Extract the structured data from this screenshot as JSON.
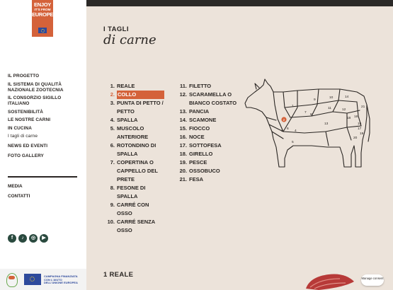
{
  "logo": {
    "line1": "ENJOY",
    "line2": "IT'S FROM",
    "line3": "EUROPE"
  },
  "nav": {
    "items": [
      {
        "label": "IL PROGETTO"
      },
      {
        "label": "IL SISTEMA DI QUALITÀ NAZIONALE ZOOTECNIA"
      },
      {
        "label": "IL CONSORZIO SIGILLO ITALIANO"
      },
      {
        "label": "SOSTENIBILITÀ"
      },
      {
        "label": "LE NOSTRE CARNI"
      },
      {
        "label": "IN CUCINA"
      },
      {
        "label": "I tagli di carne"
      },
      {
        "label": "NEWS ED EVENTI"
      },
      {
        "label": "FOTO GALLERY"
      }
    ],
    "secondary": [
      {
        "label": "MEDIA"
      },
      {
        "label": "CONTATTI"
      }
    ]
  },
  "socials": [
    {
      "icon": "facebook-icon",
      "glyph": "f"
    },
    {
      "icon": "tiktok-icon",
      "glyph": "♪"
    },
    {
      "icon": "instagram-icon",
      "glyph": "◎"
    },
    {
      "icon": "youtube-icon",
      "glyph": "▶"
    }
  ],
  "footer": {
    "funding_text": "CAMPAGNA FINANZIATA CON L'AIUTO DELL'UNIONE EUROPEA"
  },
  "header": {
    "eyebrow": "I TAGLI",
    "title": "di carne"
  },
  "cuts": {
    "column1": [
      {
        "num": "1.",
        "name": "REALE"
      },
      {
        "num": "2.",
        "name": "COLLO",
        "active": true
      },
      {
        "num": "3.",
        "name": "PUNTA DI PETTO / PETTO"
      },
      {
        "num": "4.",
        "name": "SPALLA"
      },
      {
        "num": "5.",
        "name": "MUSCOLO ANTERIORE"
      },
      {
        "num": "6.",
        "name": "ROTONDINO DI SPALLA"
      },
      {
        "num": "7.",
        "name": "COPERTINA O CAPPELLO DEL PRETE"
      },
      {
        "num": "8.",
        "name": "FESONE DI SPALLA"
      },
      {
        "num": "9.",
        "name": "CARRÉ CON OSSO"
      },
      {
        "num": "10.",
        "name": "CARRÉ SENZA OSSO"
      }
    ],
    "column2": [
      {
        "num": "11.",
        "name": "FILETTO"
      },
      {
        "num": "12.",
        "name": "SCARAMELLA O BIANCO COSTATO"
      },
      {
        "num": "13.",
        "name": "PANCIA"
      },
      {
        "num": "14.",
        "name": "SCAMONE"
      },
      {
        "num": "15.",
        "name": "FIOCCO"
      },
      {
        "num": "16.",
        "name": "NOCE"
      },
      {
        "num": "17.",
        "name": "SOTTOFESA"
      },
      {
        "num": "18.",
        "name": "GIRELLO"
      },
      {
        "num": "19.",
        "name": "PESCE"
      },
      {
        "num": "20.",
        "name": "OSSOBUCO"
      },
      {
        "num": "21.",
        "name": "FESA"
      }
    ]
  },
  "diagram": {
    "labels": [
      "1",
      "2",
      "3",
      "4",
      "5",
      "6",
      "7",
      "8",
      "9",
      "10",
      "11",
      "12",
      "13",
      "14",
      "15",
      "16",
      "17",
      "18",
      "19",
      "20",
      "21"
    ],
    "highlight": "2",
    "accent": "#d4623a"
  },
  "section": {
    "title": "1 REALE"
  },
  "consent": {
    "label": "Manage consent"
  }
}
